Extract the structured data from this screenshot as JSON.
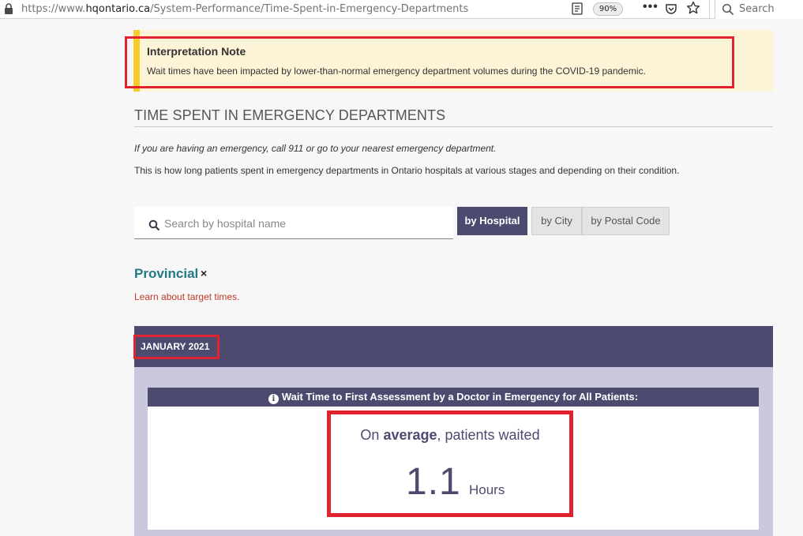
{
  "browser": {
    "url_prefix": "https://www.",
    "url_domain": "hqontario.ca",
    "url_path": "/System-Performance/Time-Spent-in-Emergency-Departments",
    "zoom": "90%",
    "search_placeholder": "Search"
  },
  "note": {
    "title": "Interpretation Note",
    "text": "Wait times have been impacted by lower-than-normal emergency department volumes during the COVID-19 pandemic."
  },
  "page": {
    "heading": "TIME SPENT IN EMERGENCY DEPARTMENTS",
    "emergency_line": "If you are having an emergency, call 911 or go to your nearest emergency department.",
    "intro": "This is how long patients spent in emergency departments in Ontario hospitals at various stages and depending on their condition."
  },
  "search": {
    "placeholder": "Search by hospital name",
    "tabs": {
      "hospital": "by Hospital",
      "city": "by City",
      "postal": "by Postal Code"
    }
  },
  "filter": {
    "selected": "Provincial",
    "remove": "×",
    "learn_link": "Learn about target times."
  },
  "report": {
    "month": "JANUARY 2021",
    "card_title": "Wait Time to First Assessment by a Doctor in Emergency for All Patients:",
    "info_glyph": "i",
    "avg_prefix": "On ",
    "avg_bold": "average",
    "avg_suffix": ", patients waited",
    "value": "1.1",
    "unit": "Hours"
  },
  "colors": {
    "accent": "#4d4a70",
    "highlight_outline": "#e0242f",
    "note_bg": "#fdf3d6",
    "note_bar": "#f5cc2b",
    "link_teal": "#237a83",
    "link_red": "#c1392b"
  }
}
